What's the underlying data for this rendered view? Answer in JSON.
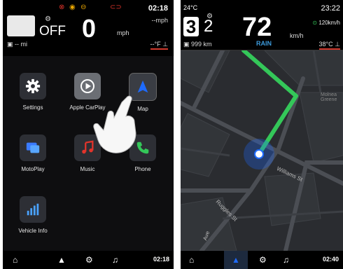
{
  "left": {
    "status": {
      "gear_label": "OFF",
      "speed": "0",
      "speed_unit": "mph",
      "clock": "02:18",
      "top_right_speed": "--mph",
      "odometer": "-- mi",
      "temperature": "--°F"
    },
    "apps": [
      {
        "label": "Settings",
        "icon": "gear-icon"
      },
      {
        "label": "Apple CarPlay",
        "icon": "carplay-icon"
      },
      {
        "label": "Map",
        "icon": "navigation-arrow-icon"
      },
      {
        "label": "MotoPlay",
        "icon": "motoplay-icon"
      },
      {
        "label": "Music",
        "icon": "music-note-icon"
      },
      {
        "label": "Phone",
        "icon": "phone-icon"
      },
      {
        "label": "Vehicle Info",
        "icon": "bar-chart-icon"
      }
    ],
    "bottom_clock": "02:18"
  },
  "right": {
    "status": {
      "outside_temp": "24°C",
      "clock": "23:22",
      "gear": "3",
      "gear_secondary": "2",
      "speed": "72",
      "speed_unit": "km/h",
      "speed_limit": "120km/h",
      "odometer": "999 km",
      "weather": "RAIN",
      "engine_temp": "38°C"
    },
    "map": {
      "street_1": "Williams St",
      "street_2": "Ruggles St",
      "street_3": "Ave",
      "area_name": "Molnea Greene"
    },
    "bottom_clock": "02:40"
  },
  "colors": {
    "route": "#34c759",
    "nav_blue": "#1e6bff",
    "warning_red": "#e2342b",
    "rain_blue": "#3d9bdc"
  }
}
